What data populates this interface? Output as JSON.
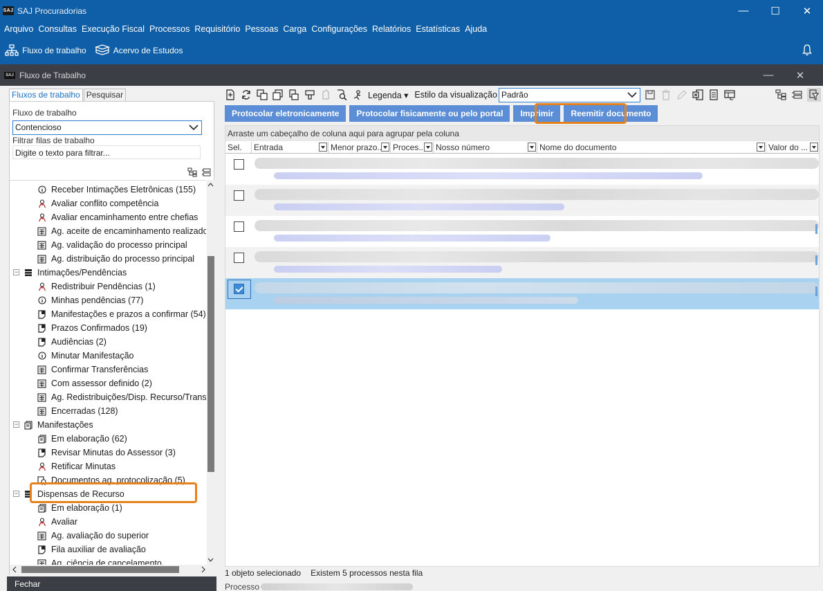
{
  "app": {
    "logo_text": "SAJ",
    "title": "SAJ Procuradorias",
    "window_controls": [
      "—",
      "☐",
      "✕"
    ]
  },
  "menu": [
    "Arquivo",
    "Consultas",
    "Execução Fiscal",
    "Processos",
    "Requisitório",
    "Pessoas",
    "Carga",
    "Configurações",
    "Relatórios",
    "Estatísticas",
    "Ajuda"
  ],
  "quickbar": {
    "workflow": "Fluxo de trabalho",
    "studies": "Acervo de Estudos"
  },
  "inner_window": {
    "logo_text": "SAJ",
    "title": "Fluxo de Trabalho",
    "controls": [
      "—",
      "✕"
    ]
  },
  "left_panel": {
    "tabs": [
      "Fluxos de trabalho",
      "Pesquisar"
    ],
    "workflow_label": "Fluxo de trabalho",
    "workflow_value": "Contencioso",
    "filter_label": "Filtrar filas de trabalho",
    "filter_placeholder": "Digite o texto para filtrar...",
    "tree": [
      {
        "label": "Receber Intimações Eletrônicas (155)",
        "icon": "info-icon",
        "level": 1
      },
      {
        "label": "Avaliar conflito competência",
        "icon": "person-icon",
        "level": 1
      },
      {
        "label": "Avaliar encaminhamento entre chefias",
        "icon": "person-icon",
        "level": 1
      },
      {
        "label": "Ag. aceite de encaminhamento realizado",
        "icon": "calc-icon",
        "level": 1
      },
      {
        "label": "Ag. validação do processo principal",
        "icon": "calc-icon",
        "level": 1
      },
      {
        "label": "Ag. distribuição do processo principal",
        "icon": "calc-icon",
        "level": 1
      },
      {
        "label": "Intimações/Pendências",
        "icon": "list-icon",
        "level": 0,
        "expander": "−"
      },
      {
        "label": "Redistribuir Pendências (1)",
        "icon": "person-icon",
        "level": 1
      },
      {
        "label": "Minhas pendências (77)",
        "icon": "info-icon",
        "level": 1
      },
      {
        "label": "Manifestações e prazos a confirmar (54)",
        "icon": "doc-icon",
        "level": 1
      },
      {
        "label": "Prazos Confirmados (19)",
        "icon": "doc-icon",
        "level": 1
      },
      {
        "label": "Audiências (2)",
        "icon": "doc-icon",
        "level": 1
      },
      {
        "label": "Minutar Manifestação",
        "icon": "info-icon",
        "level": 1
      },
      {
        "label": "Confirmar Transferências",
        "icon": "calc-icon",
        "level": 1
      },
      {
        "label": "Com assessor definido (2)",
        "icon": "calc-icon",
        "level": 1
      },
      {
        "label": "Ag. Redistribuições/Disp. Recurso/Transfer",
        "icon": "calc-icon",
        "level": 1
      },
      {
        "label": "Encerradas (128)",
        "icon": "calc-icon",
        "level": 1
      },
      {
        "label": "Manifestações",
        "icon": "pages-icon",
        "level": 0,
        "expander": "−"
      },
      {
        "label": "Em elaboração (62)",
        "icon": "pages-icon",
        "level": 1
      },
      {
        "label": "Revisar Minutas do Assessor (3)",
        "icon": "doc-icon",
        "level": 1
      },
      {
        "label": "Retificar Minutas",
        "icon": "person-icon",
        "level": 1
      },
      {
        "label": "Documentos ag. protocolização (5)",
        "icon": "stamp-icon",
        "level": 1
      },
      {
        "label": "Dispensas de Recurso",
        "icon": "list-icon",
        "level": 0,
        "expander": "−"
      },
      {
        "label": "Em elaboração (1)",
        "icon": "pages-icon",
        "level": 1
      },
      {
        "label": "Avaliar",
        "icon": "person-icon",
        "level": 1
      },
      {
        "label": "Ag. avaliação do superior",
        "icon": "calc-icon",
        "level": 1
      },
      {
        "label": "Fila auxiliar de avaliação",
        "icon": "doc-icon",
        "level": 1
      },
      {
        "label": "Ag. ciência de cancelamento",
        "icon": "calc-icon",
        "level": 1
      }
    ],
    "close_label": "Fechar"
  },
  "toolbar": {
    "legend": "Legenda",
    "view_style_label": "Estilo da visualização",
    "view_style_value": "Padrão"
  },
  "actions": [
    "Protocolar eletronicamente",
    "Protocolar fisicamente ou pelo portal",
    "Imprimir",
    "Reemitir documento"
  ],
  "grid": {
    "group_hint": "Arraste um cabeçalho de coluna aqui para agrupar pela coluna",
    "columns": [
      "Sel.",
      "Entrada",
      "Menor prazo...",
      "Proces...",
      "Nosso número",
      "Nome do documento",
      "Valor do ..."
    ],
    "rows": [
      {
        "checked": false
      },
      {
        "checked": false
      },
      {
        "checked": false
      },
      {
        "checked": false
      },
      {
        "checked": true
      }
    ]
  },
  "status": {
    "selected": "1 objeto selecionado",
    "count": "Existem 5 processos nesta fila",
    "process_label": "Processo"
  },
  "colors": {
    "brand_blue": "#0f5fa8",
    "dark_bar": "#3b3e44",
    "action_button": "#5b8ed6",
    "highlight_orange": "#e6821e",
    "selected_row": "#a9d1f0"
  }
}
